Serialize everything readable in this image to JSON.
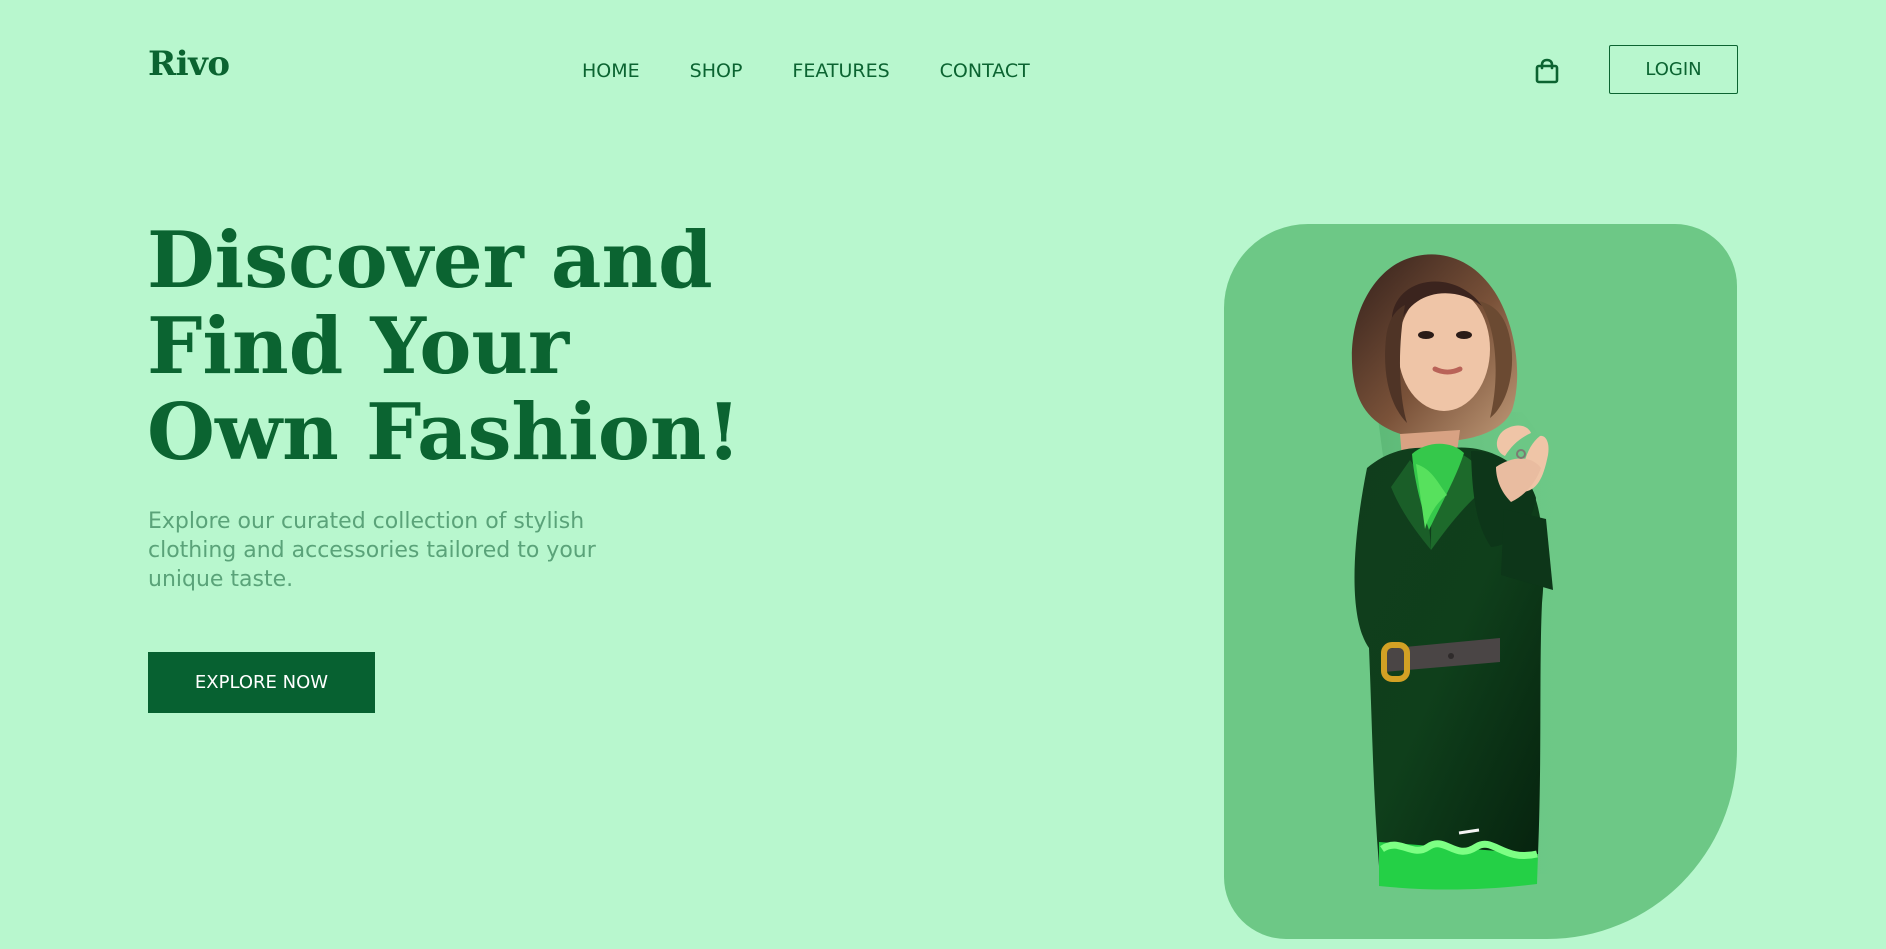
{
  "brand": {
    "name": "Rivo"
  },
  "navigation": {
    "items": [
      "HOME",
      "SHOP",
      "FEATURES",
      "CONTACT"
    ],
    "login_label": "LOGIN",
    "cart_icon": "shopping-bag-icon"
  },
  "hero": {
    "title_lines": [
      "Discover and",
      "Find Your",
      "Own Fashion!"
    ],
    "description_lines": [
      "Explore our curated collection of stylish",
      "clothing and accessories tailored to your",
      "unique taste."
    ],
    "cta_label": "EXPLORE NOW"
  },
  "colors": {
    "background": "#b8f7ce",
    "primary": "#0b6431",
    "muted_text": "#5aa379",
    "card": "#6dc886",
    "button": "#076131"
  }
}
